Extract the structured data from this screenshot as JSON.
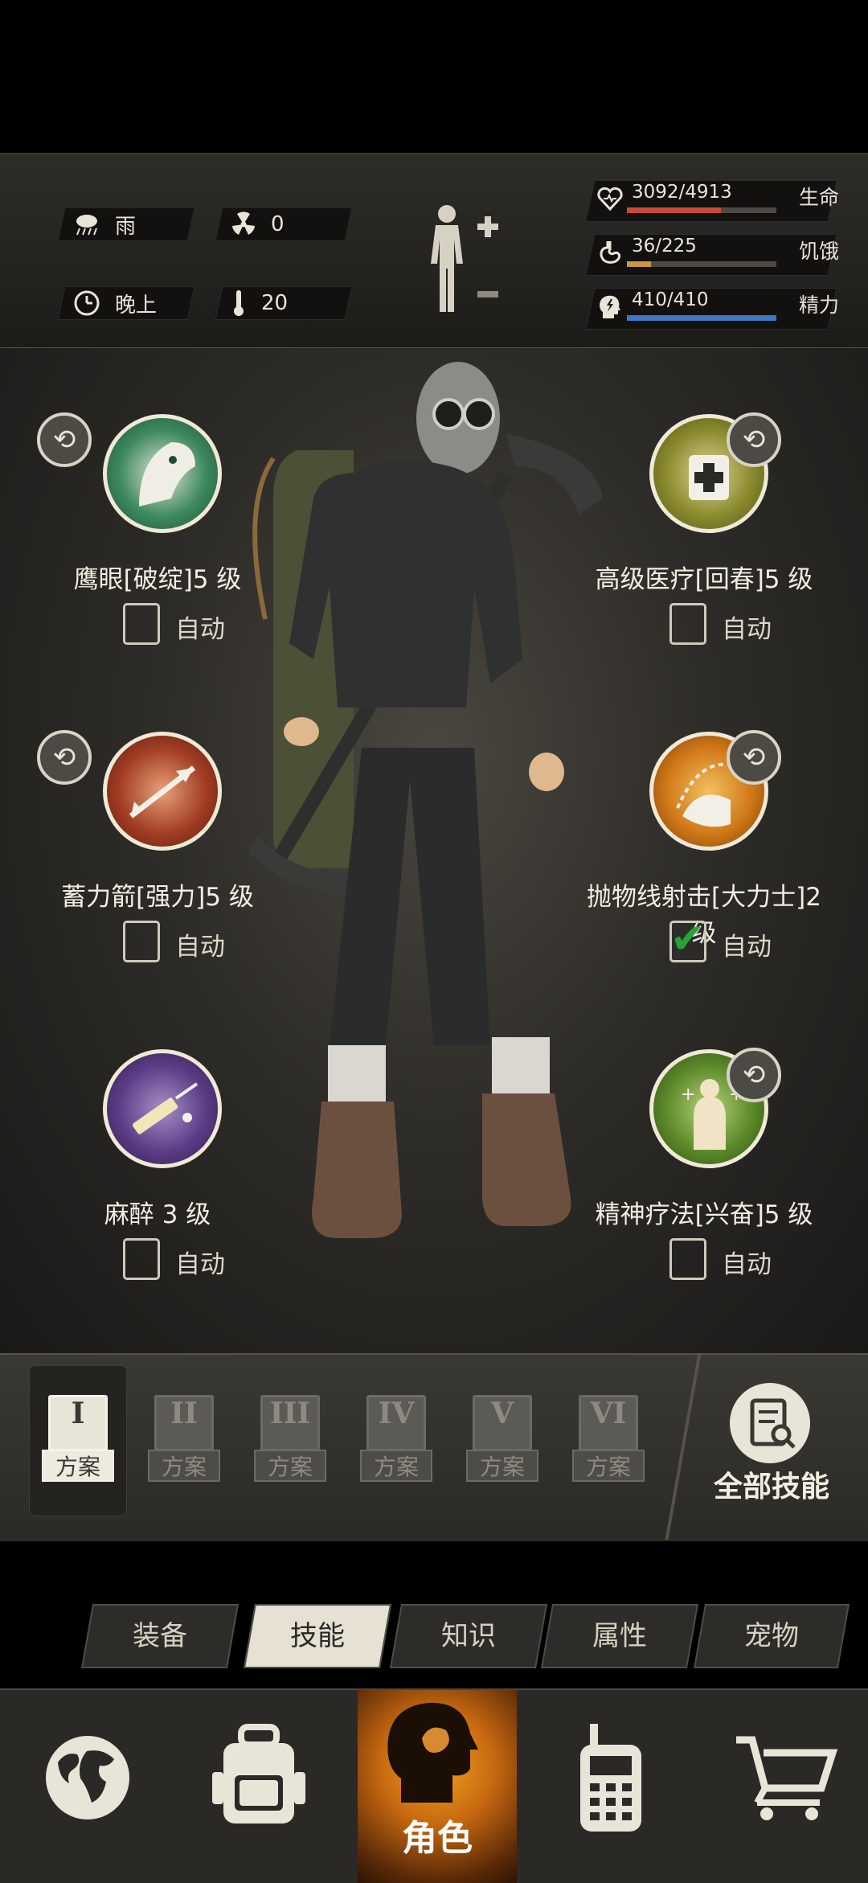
{
  "status": {
    "weather": "雨",
    "radiation": "0",
    "time_of_day": "晚上",
    "temperature": "20",
    "stats": [
      {
        "name": "生命",
        "value": "3092/4913",
        "level": 0.629,
        "color": "#c94a3b"
      },
      {
        "name": "饥饿",
        "value": "36/225",
        "level": 0.16,
        "color": "#c99a3b"
      },
      {
        "name": "精力",
        "value": "410/410",
        "level": 1.0,
        "color": "#3f78c2"
      }
    ]
  },
  "skills": [
    {
      "title": "鹰眼[破绽]5 级",
      "auto_label": "自动",
      "auto_checked": false,
      "icon": "eagle-eye-icon"
    },
    {
      "title": "高级医疗[回春]5 级",
      "auto_label": "自动",
      "auto_checked": false,
      "icon": "medical-kit-icon"
    },
    {
      "title": "蓄力箭[强力]5 级",
      "auto_label": "自动",
      "auto_checked": false,
      "icon": "charged-arrow-icon"
    },
    {
      "title": "抛物线射击[大力士]2 级",
      "auto_label": "自动",
      "auto_checked": true,
      "icon": "parabolic-shot-icon"
    },
    {
      "title": "麻醉 3 级",
      "auto_label": "自动",
      "auto_checked": false,
      "icon": "syringe-icon"
    },
    {
      "title": "精神疗法[兴奋]5 级",
      "auto_label": "自动",
      "auto_checked": false,
      "icon": "mental-therapy-icon"
    }
  ],
  "plans": [
    {
      "numeral": "I",
      "label": "方案"
    },
    {
      "numeral": "II",
      "label": "方案"
    },
    {
      "numeral": "III",
      "label": "方案"
    },
    {
      "numeral": "IV",
      "label": "方案"
    },
    {
      "numeral": "V",
      "label": "方案"
    },
    {
      "numeral": "VI",
      "label": "方案"
    }
  ],
  "all_skills_label": "全部技能",
  "tabs": [
    "装备",
    "技能",
    "知识",
    "属性",
    "宠物"
  ],
  "active_tab": "技能",
  "nav": {
    "active_label": "角色",
    "items": [
      "globe-icon",
      "backpack-icon",
      "character-icon",
      "radio-icon",
      "cart-icon"
    ]
  }
}
